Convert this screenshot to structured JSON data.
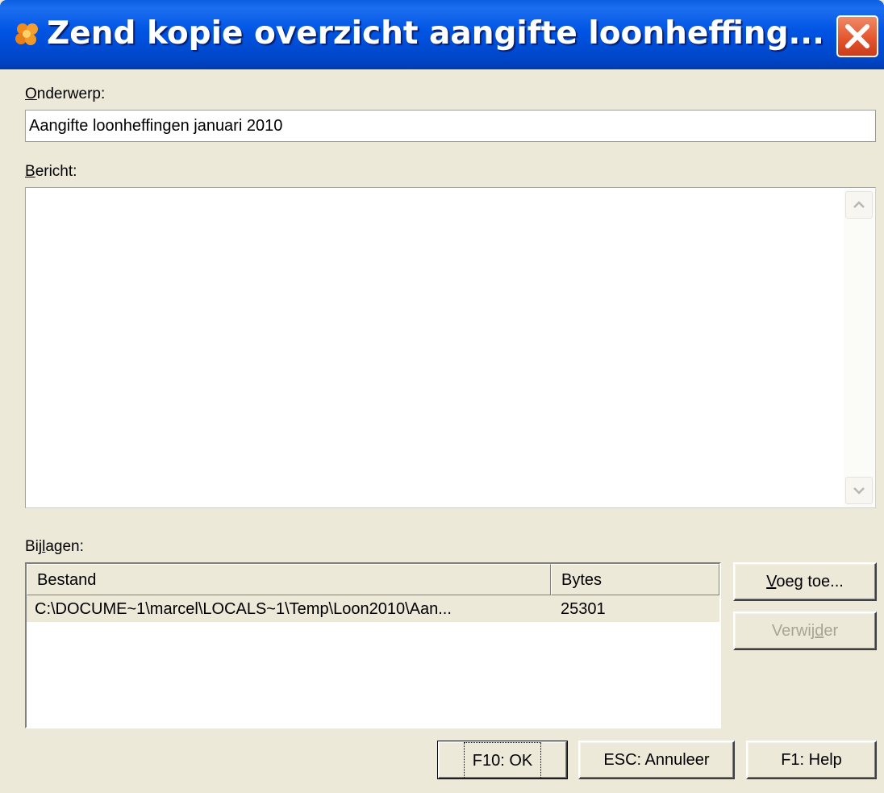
{
  "window": {
    "title": "Zend kopie overzicht aangifte loonheffing...",
    "icon": "orange-flower-icon",
    "close_icon": "close-icon"
  },
  "subject": {
    "label_prefix": "O",
    "label_rest": "nderwerp:",
    "value": "Aangifte loonheffingen januari 2010"
  },
  "message": {
    "label_prefix": "B",
    "label_rest": "ericht:",
    "value": ""
  },
  "attachments": {
    "label_pre": "Bij",
    "label_u": "l",
    "label_post": "agen:",
    "columns": [
      "Bestand",
      "Bytes"
    ],
    "rows": [
      {
        "file": "C:\\DOCUME~1\\marcel\\LOCALS~1\\Temp\\Loon2010\\Aan...",
        "bytes": "25301"
      }
    ]
  },
  "side_buttons": {
    "add_u": "V",
    "add_rest": "oeg toe...",
    "remove_pre": "Verwij",
    "remove_u": "d",
    "remove_post": "er"
  },
  "footer_buttons": {
    "ok": "F10: OK",
    "cancel": "ESC: Annuleer",
    "help": "F1: Help"
  },
  "colors": {
    "titlebar": "#0054e3",
    "close": "#e2532c",
    "dialog_bg": "#ece9d8"
  }
}
